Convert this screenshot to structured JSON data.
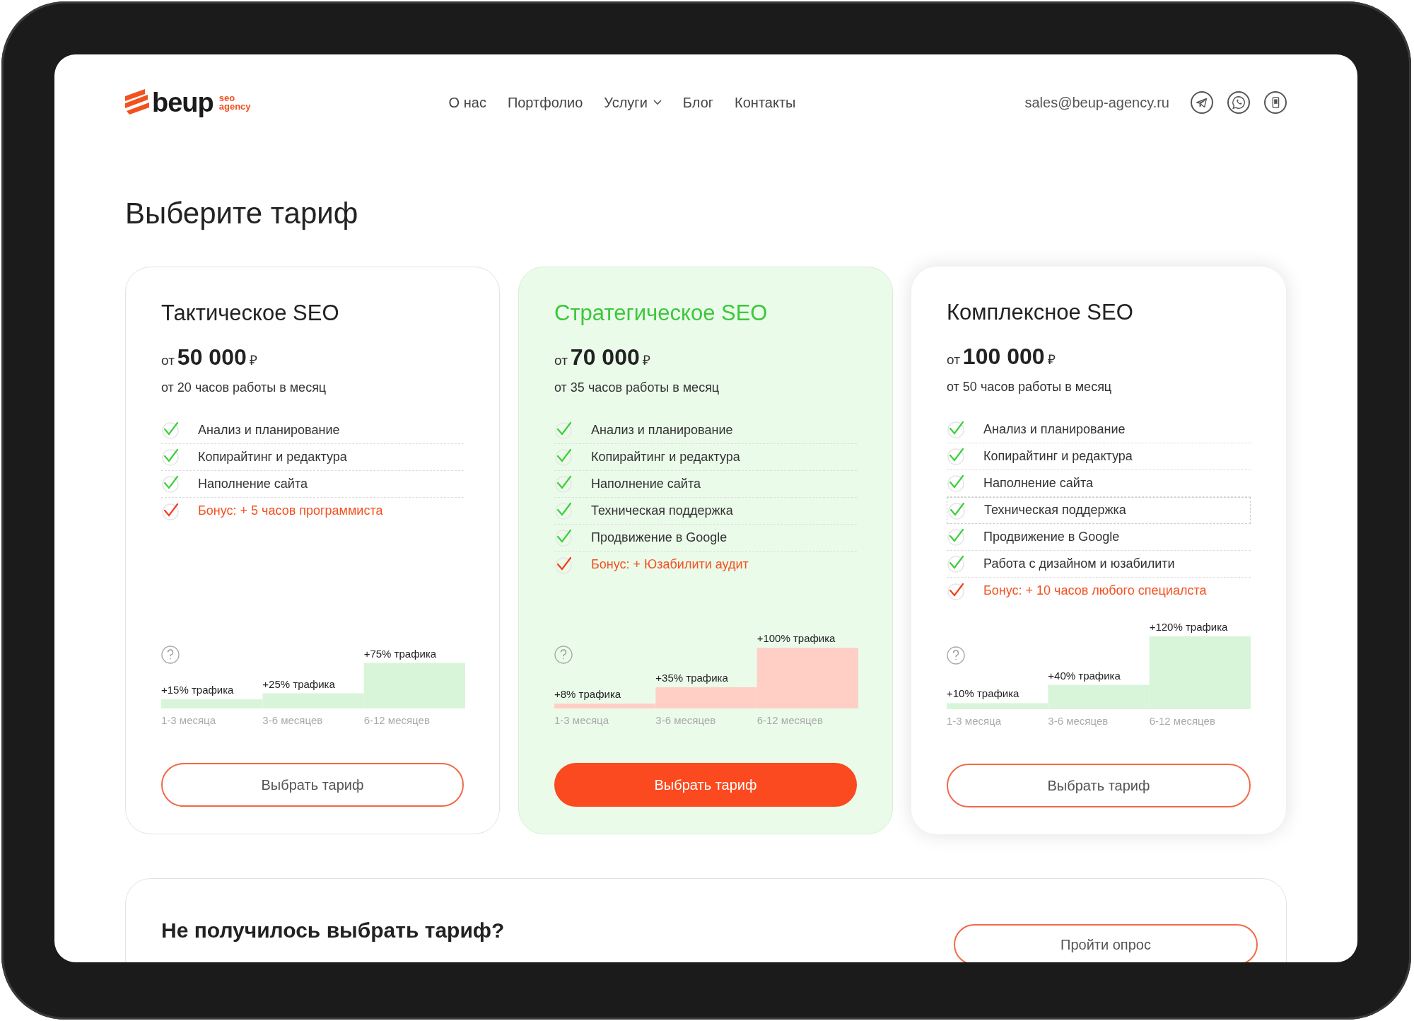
{
  "header": {
    "logo": {
      "wordmark": "beup",
      "tagline_top": "seo",
      "tagline_bottom": "agency"
    },
    "nav": [
      {
        "label": "О нас",
        "dropdown": false
      },
      {
        "label": "Портфолио",
        "dropdown": false
      },
      {
        "label": "Услуги",
        "dropdown": true
      },
      {
        "label": "Блог",
        "dropdown": false
      },
      {
        "label": "Контакты",
        "dropdown": false
      }
    ],
    "email": "sales@beup-agency.ru"
  },
  "title": "Выберите тариф",
  "plans": [
    {
      "kind": "outline",
      "title": "Тактическое SEO",
      "price_prefix": "от",
      "price": "50 000",
      "currency": "₽",
      "hours": "от 20 часов работы в месяц",
      "features": [
        {
          "text": "Анализ и планирование",
          "bonus": false,
          "highlighted": false
        },
        {
          "text": "Копирайтинг и редактура",
          "bonus": false,
          "highlighted": false
        },
        {
          "text": "Наполнение сайта",
          "bonus": false,
          "highlighted": false
        },
        {
          "text": "Бонус: + 5 часов программиста",
          "bonus": true,
          "highlighted": false
        }
      ],
      "chart_data": {
        "type": "bar",
        "categories": [
          "1-3 месяца",
          "3-6 месяцев",
          "6-12 месяцев"
        ],
        "series": [
          {
            "color": "#d9f5d9",
            "values": [
              15,
              25,
              75
            ],
            "value_labels": [
              "+15% трафика",
              "+25% трафика",
              "+75% трафика"
            ]
          }
        ]
      },
      "button": "Выбрать тариф"
    },
    {
      "kind": "featured",
      "title": "Стратегическое SEO",
      "price_prefix": "от",
      "price": "70 000",
      "currency": "₽",
      "hours": "от 35 часов работы в месяц",
      "features": [
        {
          "text": "Анализ и планирование",
          "bonus": false,
          "highlighted": false
        },
        {
          "text": "Копирайтинг и редактура",
          "bonus": false,
          "highlighted": false
        },
        {
          "text": "Наполнение сайта",
          "bonus": false,
          "highlighted": false
        },
        {
          "text": "Техническая поддержка",
          "bonus": false,
          "highlighted": false
        },
        {
          "text": "Продвижение в Google",
          "bonus": false,
          "highlighted": false
        },
        {
          "text": "Бонус: + Юзабилити аудит",
          "bonus": true,
          "highlighted": false
        }
      ],
      "chart_data": {
        "type": "bar",
        "categories": [
          "1-3 месяца",
          "3-6 месяцев",
          "6-12 месяцев"
        ],
        "series": [
          {
            "color": "#ffcfc6",
            "values": [
              8,
              35,
              100
            ],
            "value_labels": [
              "+8% трафика",
              "+35% трафика",
              "+100% трафика"
            ]
          }
        ]
      },
      "button": "Выбрать тариф"
    },
    {
      "kind": "raised",
      "title": "Комплексное SEO",
      "price_prefix": "от",
      "price": "100 000",
      "currency": "₽",
      "hours": "от 50 часов работы в месяц",
      "features": [
        {
          "text": "Анализ и планирование",
          "bonus": false,
          "highlighted": false
        },
        {
          "text": "Копирайтинг и редактура",
          "bonus": false,
          "highlighted": false
        },
        {
          "text": "Наполнение сайта",
          "bonus": false,
          "highlighted": false
        },
        {
          "text": "Техническая поддержка",
          "bonus": false,
          "highlighted": true
        },
        {
          "text": "Продвижение в Google",
          "bonus": false,
          "highlighted": false
        },
        {
          "text": "Работа с дизайном и юзабилити",
          "bonus": false,
          "highlighted": false
        },
        {
          "text": "Бонус: + 10 часов любого специалста",
          "bonus": true,
          "highlighted": false
        }
      ],
      "chart_data": {
        "type": "bar",
        "categories": [
          "1-3 месяца",
          "3-6 месяцев",
          "6-12 месяцев"
        ],
        "series": [
          {
            "color": "#d9f5d9",
            "values": [
              10,
              40,
              120
            ],
            "value_labels": [
              "+10% трафика",
              "+40% трафика",
              "+120% трафика"
            ]
          }
        ]
      },
      "button": "Выбрать тариф"
    }
  ],
  "survey": {
    "title": "Не получилось выбрать тариф?",
    "button": "Пройти опрос"
  }
}
